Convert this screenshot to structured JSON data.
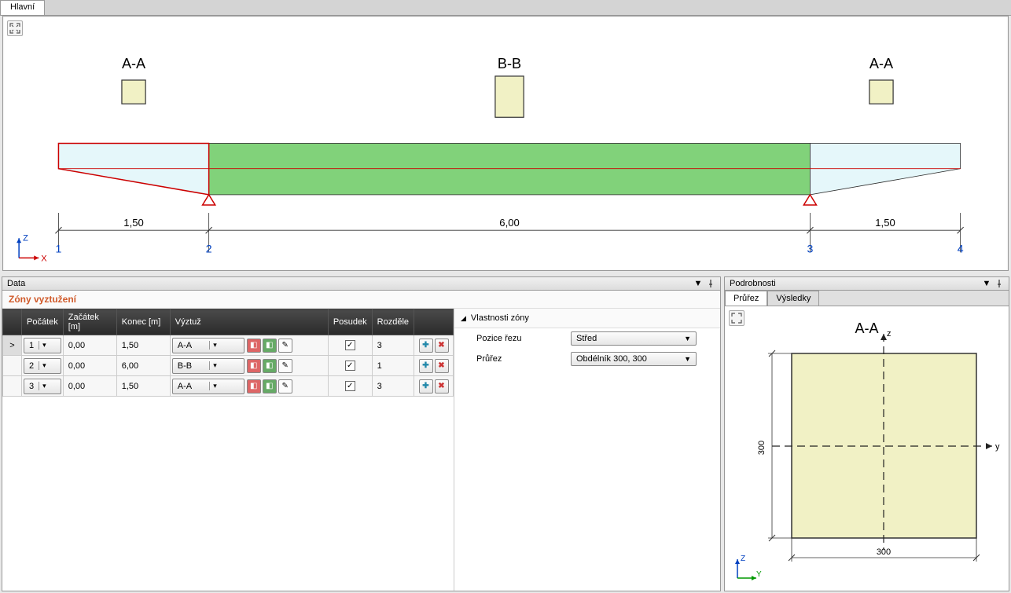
{
  "main_tab": "Hlavní",
  "sections": {
    "left": "A-A",
    "mid": "B-B",
    "right": "A-A"
  },
  "dims": {
    "d1": "1,50",
    "d2": "6,00",
    "d3": "1,50",
    "n1": "1",
    "n2": "2",
    "n3": "3",
    "n4": "4"
  },
  "axes": {
    "z": "Z",
    "x": "X",
    "y": "Y"
  },
  "data_panel": {
    "title": "Data",
    "subtitle": "Zóny vyztužení",
    "cols": {
      "c1": "Počátek",
      "c2": "Začátek [m]",
      "c3": "Konec [m]",
      "c4": "Výztuž",
      "c5": "Posudek",
      "c6": "Rozděle"
    },
    "rows": [
      {
        "num": "1",
        "start": "0,00",
        "end": "1,50",
        "rebar": "A-A",
        "check": "✓",
        "split": "3"
      },
      {
        "num": "2",
        "start": "0,00",
        "end": "6,00",
        "rebar": "B-B",
        "check": "✓",
        "split": "1"
      },
      {
        "num": "3",
        "start": "0,00",
        "end": "1,50",
        "rebar": "A-A",
        "check": "✓",
        "split": "3"
      }
    ]
  },
  "props": {
    "title": "Vlastnosti zóny",
    "pos_label": "Pozice řezu",
    "pos_value": "Střed",
    "sec_label": "Průřez",
    "sec_value": "Obdélník 300, 300"
  },
  "details": {
    "title": "Podrobnosti",
    "tab1": "Průřez",
    "tab2": "Výsledky",
    "section_name": "A-A",
    "dim_w": "300",
    "dim_h": "300",
    "ax_y": "y",
    "ax_z": "z"
  }
}
